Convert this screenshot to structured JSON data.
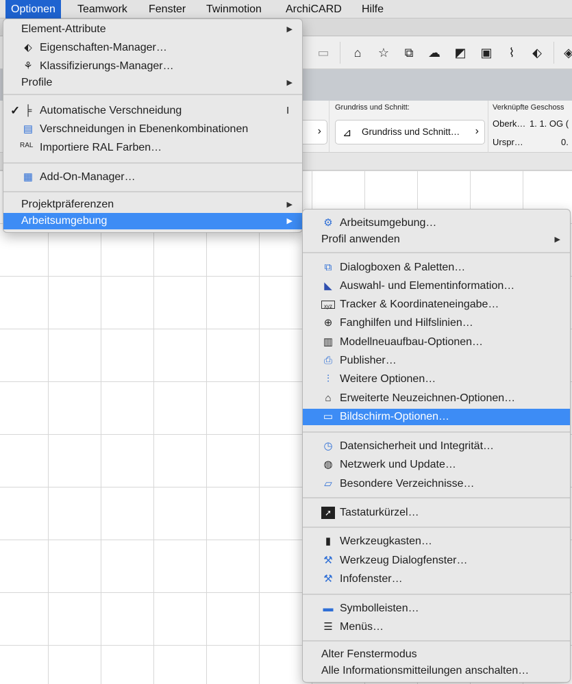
{
  "menubar": {
    "items": [
      "Optionen",
      "Teamwork",
      "Fenster",
      "Twinmotion",
      "ArchiCARD",
      "Hilfe"
    ]
  },
  "infobox": {
    "section_label": "Grundriss und Schnitt:",
    "section_button": "Grundriss und Schnitt…",
    "linked_label": "Verknüpfte Geschoss",
    "row1_a": "Oberk…",
    "row1_b": "1. 1. OG (",
    "row2_a": "Urspr…",
    "row2_b": "0."
  },
  "options_menu": {
    "element_attribute": "Element-Attribute",
    "eigenschaften": "Eigenschaften-Manager…",
    "klassifizierung": "Klassifizierungs-Manager…",
    "profile": "Profile",
    "auto_verschneidung": "Automatische Verschneidung",
    "auto_verschneidung_shortcut": "I",
    "verschneidungen_ebenen": "Verschneidungen in Ebenenkombinationen",
    "ral": "Importiere RAL Farben…",
    "addon": "Add-On-Manager…",
    "projektpraeferenzen": "Projektpräferenzen",
    "arbeitsumgebung": "Arbeitsumgebung"
  },
  "submenu": {
    "arbeitsumgebung": "Arbeitsumgebung…",
    "profil_anwenden": "Profil anwenden",
    "dialogboxen": "Dialogboxen & Paletten…",
    "auswahl": "Auswahl- und Elementinformation…",
    "tracker": "Tracker & Koordinateneingabe…",
    "fanghilfen": "Fanghilfen und Hilfslinien…",
    "modellneuaufbau": "Modellneuaufbau-Optionen…",
    "publisher": "Publisher…",
    "weitere": "Weitere Optionen…",
    "erweiterte": "Erweiterte Neuzeichnen-Optionen…",
    "bildschirm": "Bildschirm-Optionen…",
    "datensicherheit": "Datensicherheit und Integrität…",
    "netzwerk": "Netzwerk und Update…",
    "verzeichnisse": "Besondere Verzeichnisse…",
    "tastatur": "Tastaturkürzel…",
    "werkzeugkasten": "Werkzeugkasten…",
    "werkzeug_dialog": "Werkzeug Dialogfenster…",
    "infofenster": "Infofenster…",
    "symbolleisten": "Symbolleisten…",
    "menues": "Menüs…",
    "alter_fenstermodus": "Alter Fenstermodus",
    "alle_info": "Alle Informationsmitteilungen anschalten…"
  },
  "icons": {
    "submenu_arrow": "▶",
    "button_chevron": "›",
    "checkmark": "✓"
  },
  "colors": {
    "menubar_active": "#1e63d0",
    "menu_highlight": "#3d8cf5"
  }
}
